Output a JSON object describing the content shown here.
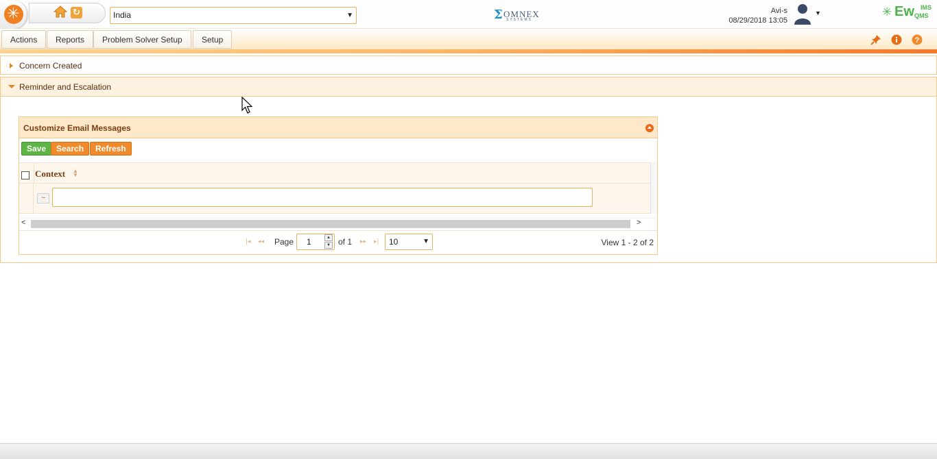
{
  "header": {
    "country_value": "India",
    "brand_name": "OMNEX",
    "brand_sub": "SYSTEMS",
    "user_name": "Avi-s",
    "datetime": "08/29/2018 13:05",
    "product_logo_ew": "Ew",
    "product_logo_ims": "IMS",
    "product_logo_qms": "QMS"
  },
  "menu": {
    "items": [
      {
        "label": "Actions"
      },
      {
        "label": "Reports"
      },
      {
        "label": "Problem Solver Setup"
      },
      {
        "label": "Setup"
      }
    ],
    "right_icons": [
      "pin-icon",
      "info-icon",
      "help-icon"
    ]
  },
  "accordion": {
    "sections": [
      {
        "label": "Concern Created",
        "expanded": false
      },
      {
        "label": "Reminder and Escalation",
        "expanded": true
      }
    ]
  },
  "panel": {
    "title": "Customize Email Messages",
    "buttons": {
      "save": "Save",
      "search": "Search",
      "refresh": "Refresh"
    },
    "grid": {
      "columns": [
        "Context"
      ],
      "filter_operator": "~",
      "filter_value": ""
    },
    "pager": {
      "page_label": "Page",
      "page_value": "1",
      "of_label": "of 1",
      "page_size": "10",
      "view_text": "View 1 - 2 of 2"
    }
  },
  "colors": {
    "accent_orange": "#f08a2a",
    "save_green": "#5cb544",
    "panel_header": "#fde9c9",
    "title_brown": "#7a3c12"
  }
}
